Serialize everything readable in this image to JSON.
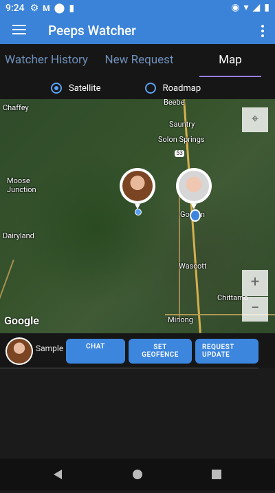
{
  "status": {
    "time": "9:24"
  },
  "appbar": {
    "title": "Peeps Watcher"
  },
  "tabs": [
    {
      "label": "Watcher History"
    },
    {
      "label": "New Request"
    },
    {
      "label": "Map"
    }
  ],
  "map_type": {
    "satellite": "Satellite",
    "roadmap": "Roadmap",
    "selected": "Satellite"
  },
  "map": {
    "labels": [
      "Chaffey",
      "Beebe",
      "Sauntry",
      "Solon Springs",
      "53",
      "Moose Junction",
      "Dairyland",
      "Gordon",
      "Wascott",
      "Chittamo",
      "Minong"
    ],
    "logo": "Google",
    "zoom_in": "+",
    "zoom_out": "−"
  },
  "bottom": {
    "name": "Sample",
    "chat": "CHAT",
    "geofence": "SET GEOFENCE",
    "request_update": "REQUEST UPDATE"
  }
}
